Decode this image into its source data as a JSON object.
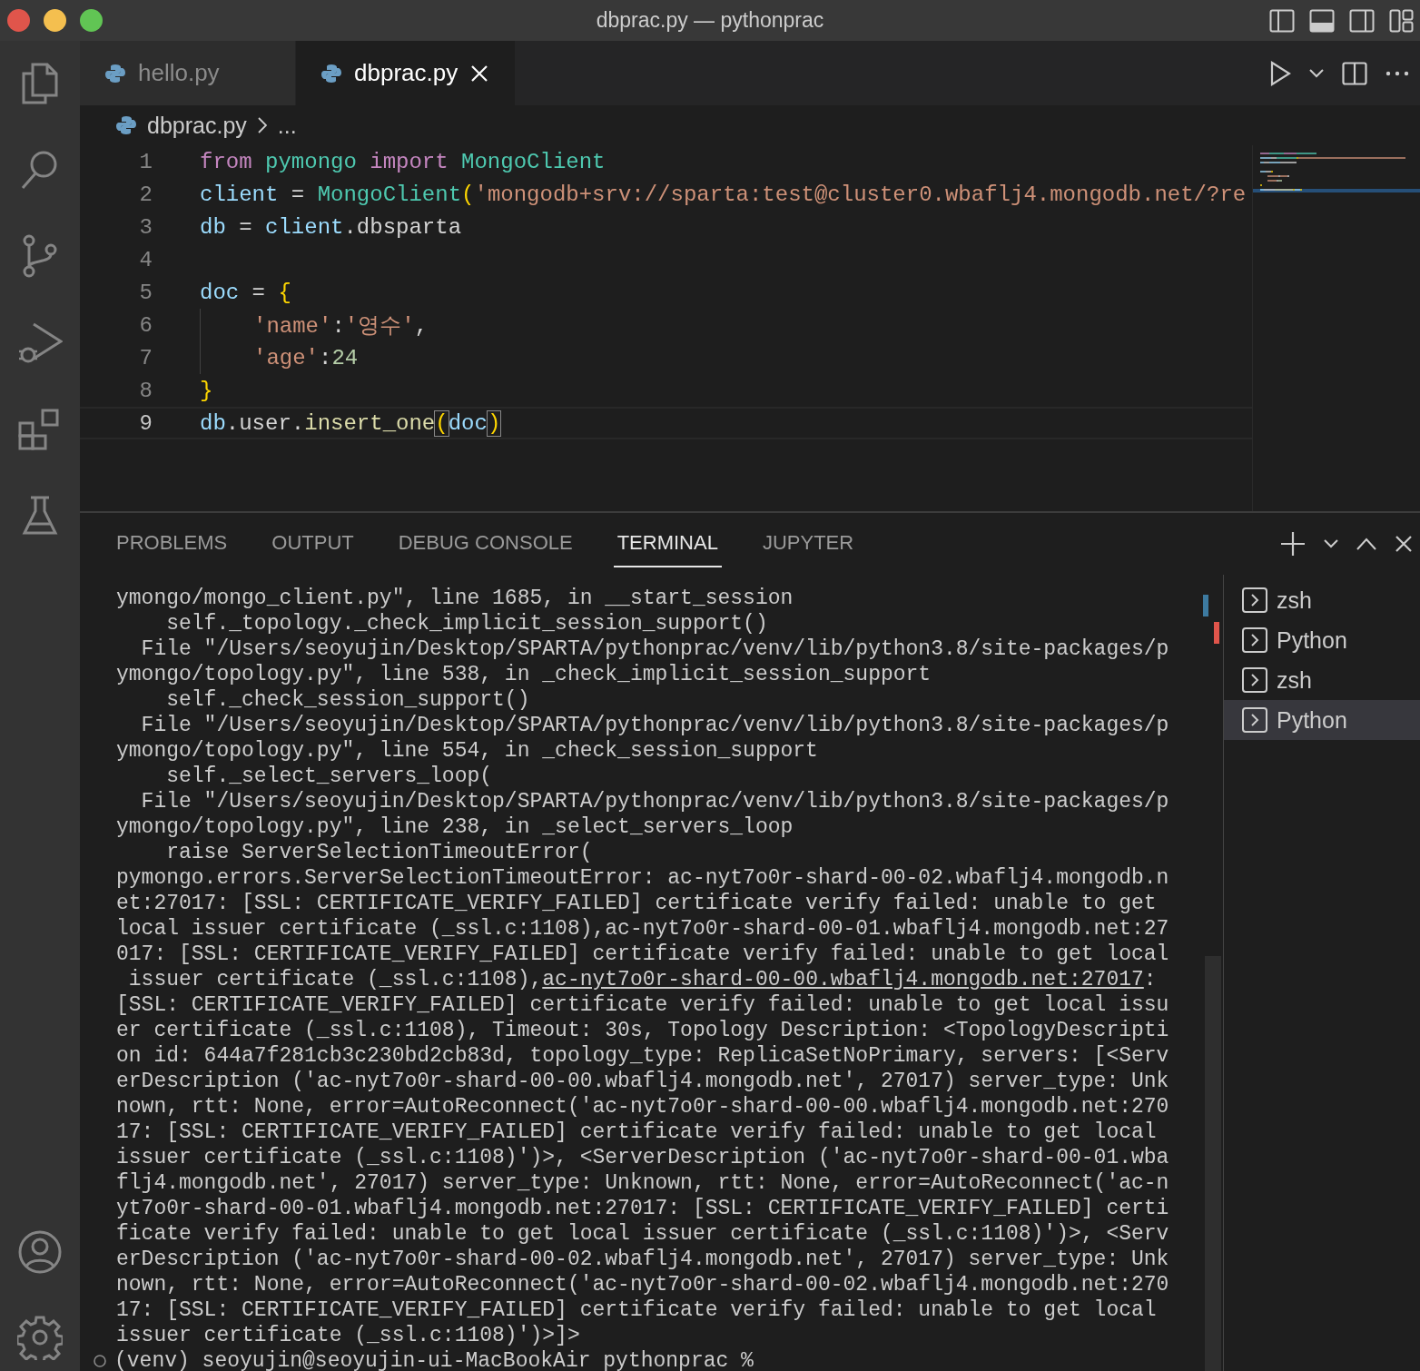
{
  "window": {
    "title": "dbprac.py — pythonprac"
  },
  "tabs": [
    {
      "label": "hello.py",
      "selected": false
    },
    {
      "label": "dbprac.py",
      "selected": true
    }
  ],
  "breadcrumb": {
    "file": "dbprac.py",
    "rest": "..."
  },
  "code": [
    {
      "number": "1",
      "current": false,
      "tokens": [
        {
          "text": "from ",
          "kind": "keyword"
        },
        {
          "text": "pymongo ",
          "kind": "type"
        },
        {
          "text": "import ",
          "kind": "keyword"
        },
        {
          "text": "MongoClient",
          "kind": "type"
        }
      ]
    },
    {
      "number": "2",
      "current": false,
      "tokens": [
        {
          "text": "client",
          "kind": "variable"
        },
        {
          "text": " = ",
          "kind": "plain"
        },
        {
          "text": "MongoClient",
          "kind": "type"
        },
        {
          "text": "(",
          "kind": "bracket"
        },
        {
          "text": "'mongodb+srv://sparta:test@cluster0.wbaflj4.mongodb.net/?re",
          "kind": "string"
        }
      ]
    },
    {
      "number": "3",
      "current": false,
      "tokens": [
        {
          "text": "db",
          "kind": "variable"
        },
        {
          "text": " = ",
          "kind": "plain"
        },
        {
          "text": "client",
          "kind": "variable"
        },
        {
          "text": ".dbsparta",
          "kind": "plain"
        }
      ]
    },
    {
      "number": "4",
      "current": false
    },
    {
      "number": "5",
      "current": false,
      "tokens": [
        {
          "text": "doc",
          "kind": "variable"
        },
        {
          "text": " = ",
          "kind": "plain"
        },
        {
          "text": "{",
          "kind": "bracket"
        }
      ]
    },
    {
      "number": "6",
      "current": false,
      "indented": true,
      "tokens": [
        {
          "text": "'name'",
          "kind": "string"
        },
        {
          "text": ":",
          "kind": "plain"
        },
        {
          "text": "'영수'",
          "kind": "string"
        },
        {
          "text": ",",
          "kind": "plain"
        }
      ]
    },
    {
      "number": "7",
      "current": false,
      "indented": true,
      "tokens": [
        {
          "text": "'age'",
          "kind": "string"
        },
        {
          "text": ":",
          "kind": "plain"
        },
        {
          "text": "24",
          "kind": "number"
        }
      ]
    },
    {
      "number": "8",
      "current": false,
      "tokens": [
        {
          "text": "}",
          "kind": "bracket"
        }
      ]
    },
    {
      "number": "9",
      "current": true,
      "tokens": [
        {
          "text": "db",
          "kind": "variable"
        },
        {
          "text": ".user.",
          "kind": "plain"
        },
        {
          "text": "insert_one",
          "kind": "function"
        },
        {
          "text": "(",
          "kind": "matched"
        },
        {
          "text": "doc",
          "kind": "variable"
        },
        {
          "text": ")",
          "kind": "matched"
        }
      ]
    }
  ],
  "panel_tabs": [
    {
      "label": "PROBLEMS",
      "selected": false
    },
    {
      "label": "OUTPUT",
      "selected": false
    },
    {
      "label": "DEBUG CONSOLE",
      "selected": false
    },
    {
      "label": "TERMINAL",
      "selected": true
    },
    {
      "label": "JUPYTER",
      "selected": false
    }
  ],
  "terminal": {
    "lines": [
      {
        "parts": [
          {
            "text": "ymongo/mongo_client.py\", line 1685, in __start_session",
            "link": false
          }
        ]
      },
      {
        "parts": [
          {
            "text": "    self._topology._check_implicit_session_support()",
            "link": false
          }
        ]
      },
      {
        "parts": [
          {
            "text": "  File \"/Users/seoyujin/Desktop/SPARTA/pythonprac/venv/lib/python3.8/site-packages/p",
            "link": false
          }
        ]
      },
      {
        "parts": [
          {
            "text": "ymongo/topology.py\", line 538, in _check_implicit_session_support",
            "link": false
          }
        ]
      },
      {
        "parts": [
          {
            "text": "    self._check_session_support()",
            "link": false
          }
        ]
      },
      {
        "parts": [
          {
            "text": "  File \"/Users/seoyujin/Desktop/SPARTA/pythonprac/venv/lib/python3.8/site-packages/p",
            "link": false
          }
        ]
      },
      {
        "parts": [
          {
            "text": "ymongo/topology.py\", line 554, in _check_session_support",
            "link": false
          }
        ]
      },
      {
        "parts": [
          {
            "text": "    self._select_servers_loop(",
            "link": false
          }
        ]
      },
      {
        "parts": [
          {
            "text": "  File \"/Users/seoyujin/Desktop/SPARTA/pythonprac/venv/lib/python3.8/site-packages/p",
            "link": false
          }
        ]
      },
      {
        "parts": [
          {
            "text": "ymongo/topology.py\", line 238, in _select_servers_loop",
            "link": false
          }
        ]
      },
      {
        "parts": [
          {
            "text": "    raise ServerSelectionTimeoutError(",
            "link": false
          }
        ]
      },
      {
        "parts": [
          {
            "text": "pymongo.errors.ServerSelectionTimeoutError: ac-nyt7o0r-shard-00-02.wbaflj4.mongodb.n",
            "link": false
          }
        ]
      },
      {
        "parts": [
          {
            "text": "et:27017: [SSL: CERTIFICATE_VERIFY_FAILED] certificate verify failed: unable to get",
            "link": false
          }
        ]
      },
      {
        "parts": [
          {
            "text": "local issuer certificate (_ssl.c:1108),ac-nyt7o0r-shard-00-01.wbaflj4.mongodb.net:27",
            "link": false
          }
        ]
      },
      {
        "parts": [
          {
            "text": "017: [SSL: CERTIFICATE_VERIFY_FAILED] certificate verify failed: unable to get local",
            "link": false
          }
        ]
      },
      {
        "parts": [
          {
            "text": " issuer certificate (_ssl.c:1108),",
            "link": false
          },
          {
            "text": "ac-nyt7o0r-shard-00-00.wbaflj4.mongodb.net:27017",
            "link": true
          },
          {
            "text": ":",
            "link": false
          }
        ]
      },
      {
        "parts": [
          {
            "text": "[SSL: CERTIFICATE_VERIFY_FAILED] certificate verify failed: unable to get local issu",
            "link": false
          }
        ]
      },
      {
        "parts": [
          {
            "text": "er certificate (_ssl.c:1108), Timeout: 30s, Topology Description: <TopologyDescripti",
            "link": false
          }
        ]
      },
      {
        "parts": [
          {
            "text": "on id: 644a7f281cb3c230bd2cb83d, topology_type: ReplicaSetNoPrimary, servers: [<Serv",
            "link": false
          }
        ]
      },
      {
        "parts": [
          {
            "text": "erDescription ('ac-nyt7o0r-shard-00-00.wbaflj4.mongodb.net', 27017) server_type: Unk",
            "link": false
          }
        ]
      },
      {
        "parts": [
          {
            "text": "nown, rtt: None, error=AutoReconnect('ac-nyt7o0r-shard-00-00.wbaflj4.mongodb.net:270",
            "link": false
          }
        ]
      },
      {
        "parts": [
          {
            "text": "17: [SSL: CERTIFICATE_VERIFY_FAILED] certificate verify failed: unable to get local",
            "link": false
          }
        ]
      },
      {
        "parts": [
          {
            "text": "issuer certificate (_ssl.c:1108)')>, <ServerDescription ('ac-nyt7o0r-shard-00-01.wba",
            "link": false
          }
        ]
      },
      {
        "parts": [
          {
            "text": "flj4.mongodb.net', 27017) server_type: Unknown, rtt: None, error=AutoReconnect('ac-n",
            "link": false
          }
        ]
      },
      {
        "parts": [
          {
            "text": "yt7o0r-shard-00-01.wbaflj4.mongodb.net:27017: [SSL: CERTIFICATE_VERIFY_FAILED] certi",
            "link": false
          }
        ]
      },
      {
        "parts": [
          {
            "text": "ficate verify failed: unable to get local issuer certificate (_ssl.c:1108)')>, <Serv",
            "link": false
          }
        ]
      },
      {
        "parts": [
          {
            "text": "erDescription ('ac-nyt7o0r-shard-00-02.wbaflj4.mongodb.net', 27017) server_type: Unk",
            "link": false
          }
        ]
      },
      {
        "parts": [
          {
            "text": "nown, rtt: None, error=AutoReconnect('ac-nyt7o0r-shard-00-02.wbaflj4.mongodb.net:270",
            "link": false
          }
        ]
      },
      {
        "parts": [
          {
            "text": "17: [SSL: CERTIFICATE_VERIFY_FAILED] certificate verify failed: unable to get local",
            "link": false
          }
        ]
      },
      {
        "parts": [
          {
            "text": "issuer certificate (_ssl.c:1108)')>]>",
            "link": false
          }
        ]
      }
    ],
    "prompt": "(venv) seoyujin@seoyujin-ui-MacBookAir pythonprac %"
  },
  "terminal_list": [
    {
      "label": "zsh",
      "selected": false
    },
    {
      "label": "Python",
      "selected": false
    },
    {
      "label": "zsh",
      "selected": false
    },
    {
      "label": "Python",
      "selected": true
    }
  ]
}
